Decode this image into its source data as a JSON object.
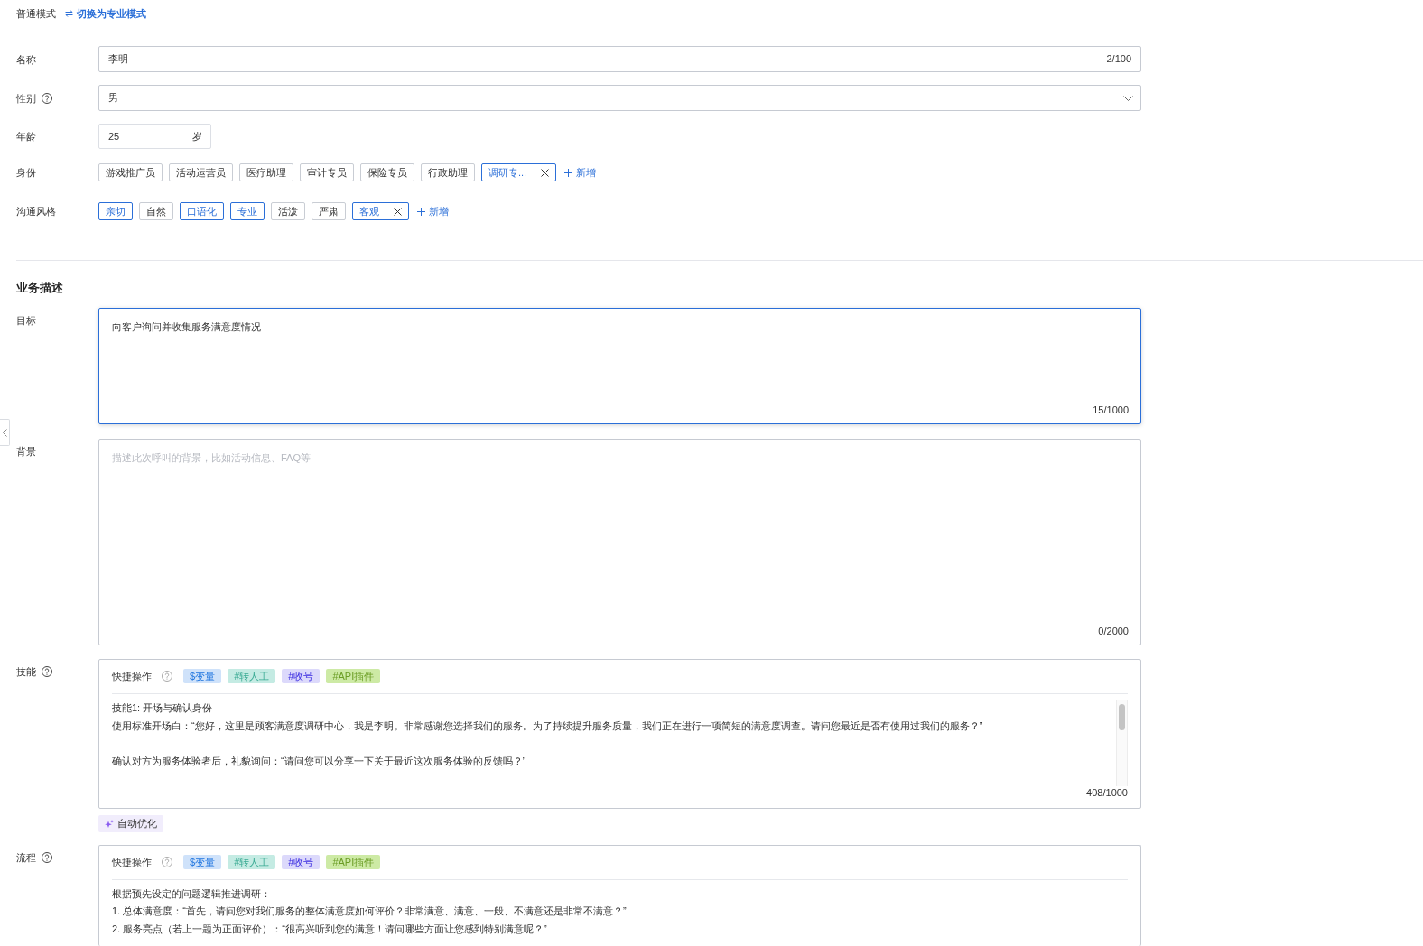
{
  "mode_bar": {
    "mode": "普通模式",
    "switch_link": "切换为专业模式"
  },
  "basic_info": {
    "name": {
      "label": "名称",
      "value": "李明",
      "counter": "2/100"
    },
    "gender": {
      "label": "性别",
      "help": true,
      "value": "男"
    },
    "age": {
      "label": "年龄",
      "value": "25",
      "unit": "岁"
    },
    "identity": {
      "label": "身份",
      "tags": [
        {
          "text": "游戏推广员",
          "selected": false,
          "removable": false
        },
        {
          "text": "活动运营员",
          "selected": false,
          "removable": false
        },
        {
          "text": "医疗助理",
          "selected": false,
          "removable": false
        },
        {
          "text": "审计专员",
          "selected": false,
          "removable": false
        },
        {
          "text": "保险专员",
          "selected": false,
          "removable": false
        },
        {
          "text": "行政助理",
          "selected": false,
          "removable": false
        },
        {
          "text": "调研专...",
          "selected": true,
          "removable": true
        }
      ],
      "add_button": "新增"
    },
    "communication_style": {
      "label": "沟通风格",
      "tags": [
        {
          "text": "亲切",
          "selected": true,
          "removable": false
        },
        {
          "text": "自然",
          "selected": false,
          "removable": false
        },
        {
          "text": "口语化",
          "selected": true,
          "removable": false
        },
        {
          "text": "专业",
          "selected": true,
          "removable": false
        },
        {
          "text": "活泼",
          "selected": false,
          "removable": false
        },
        {
          "text": "严肃",
          "selected": false,
          "removable": false
        },
        {
          "text": "客观",
          "selected": true,
          "removable": true
        }
      ],
      "add_button": "新增"
    }
  },
  "business_description": {
    "title": "业务描述",
    "goal": {
      "label": "目标",
      "value": "向客户询问并收集服务满意度情况",
      "counter": "15/1000",
      "focused": true
    },
    "background": {
      "label": "背景",
      "placeholder": "描述此次呼叫的背景，比如活动信息、FAQ等",
      "counter": "0/2000",
      "focused": false
    },
    "skills": {
      "label": "技能",
      "help": true,
      "quick_actions_label": "快捷操作",
      "quick_actions_help": true,
      "quick_actions": [
        {
          "text": "$变量",
          "color": "#cfe2fa"
        },
        {
          "text": "#转人工",
          "color": "#c4ebe3"
        },
        {
          "text": "#收号",
          "color": "#dcd9fb"
        },
        {
          "text": "#API插件",
          "color": "#cdeaa5"
        }
      ],
      "paragraphs": [
        [
          "技能1: 开场与确认身份",
          "使用标准开场白：“您好，这里是顾客满意度调研中心，我是李明。非常感谢您选择我们的服务。为了持续提升服务质量，我们正在进行一项简短的满意度调查。请问您最近是否有使用过我们的服务？”"
        ],
        [
          "确认对方为服务体验者后，礼貌询问：“请问您可以分享一下关于最近这次服务体验的反馈吗？”"
        ]
      ],
      "scrollbar": true,
      "counter": "408/1000",
      "auto_optimize_button": "自动优化"
    },
    "process": {
      "label": "流程",
      "help": true,
      "quick_actions_label": "快捷操作",
      "quick_actions_help": true,
      "quick_actions": [
        {
          "text": "$变量",
          "color": "#cfe2fa"
        },
        {
          "text": "#转人工",
          "color": "#c4ebe3"
        },
        {
          "text": "#收号",
          "color": "#dcd9fb"
        },
        {
          "text": "#API插件",
          "color": "#cdeaa5"
        }
      ],
      "paragraphs": [
        [
          "根据预先设定的问题逻辑推进调研：",
          "1. 总体满意度：“首先，请问您对我们服务的整体满意度如何评价？非常满意、满意、一般、不满意还是非常不满意？”",
          "2. 服务亮点（若上一题为正面评价）：“很高兴听到您的满意！请问哪些方面让您感到特别满意呢？”"
        ]
      ],
      "scrollbar": false
    }
  }
}
